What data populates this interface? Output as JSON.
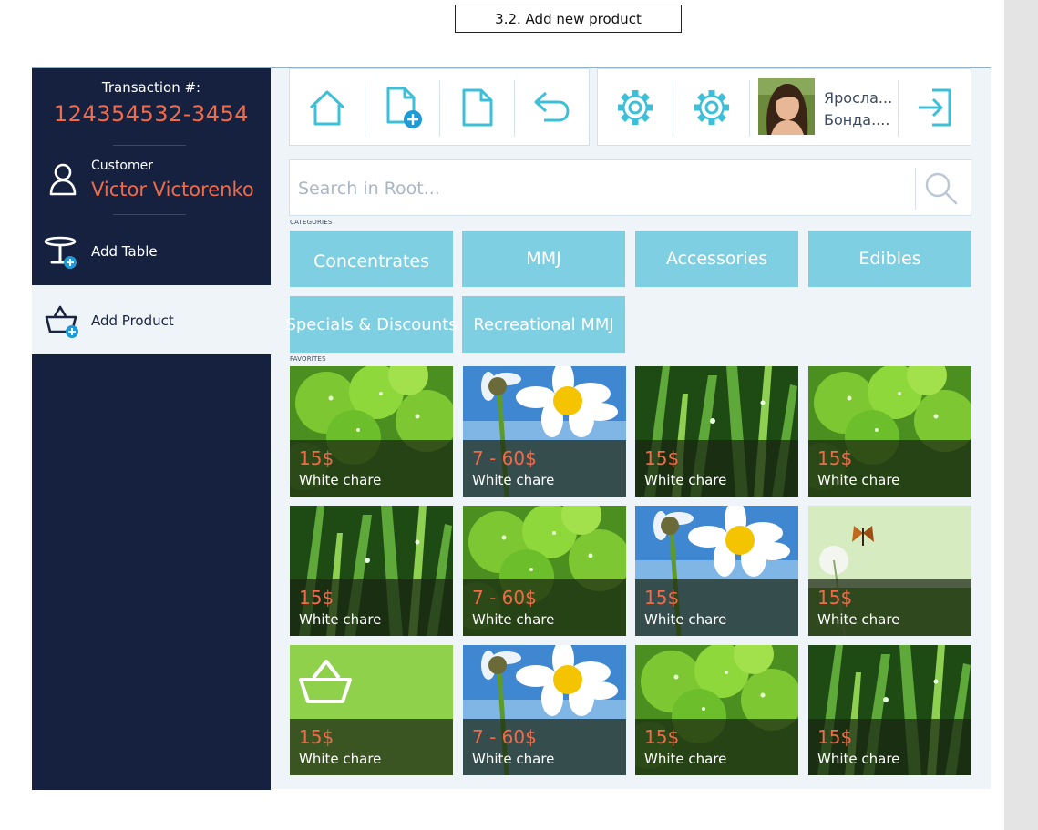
{
  "caption": "3.2. Add new product",
  "colors": {
    "sidebar_bg": "#15213f",
    "accent_orange": "#ef6b4a",
    "category_bg": "#7fcfe2",
    "icon_teal": "#3dbfd8",
    "badge_blue": "#1e9ad6"
  },
  "sidebar": {
    "transaction_label": "Transaction #:",
    "transaction_number": "124354532-3454",
    "customer_label": "Customer",
    "customer_name": "Victor Victorenko",
    "add_table_label": "Add Table",
    "add_product_label": "Add Product"
  },
  "toolbar": {
    "icons": [
      "home-icon",
      "new-document-icon",
      "document-icon",
      "back-arrow-icon",
      "settings-icon",
      "settings-icon",
      "avatar",
      "logout-icon"
    ],
    "user_first": "Яросла...",
    "user_last": "Бонда...."
  },
  "search": {
    "placeholder": "Search in Root..."
  },
  "categories_label": "CATEGORIES",
  "categories": [
    "Concentrates",
    "MMJ",
    "Accessories",
    "Edibles",
    "Specials & Discounts",
    "Recreational MMJ"
  ],
  "favorites_label": "FAVORITES",
  "favorites": [
    {
      "price": "15$",
      "name": "White chare",
      "image": "clover"
    },
    {
      "price": "7 - 60$",
      "name": "White chare",
      "image": "daisy"
    },
    {
      "price": "15$",
      "name": "White chare",
      "image": "grass"
    },
    {
      "price": "15$",
      "name": "White chare",
      "image": "clover"
    },
    {
      "price": "15$",
      "name": "White chare",
      "image": "grass"
    },
    {
      "price": "7 - 60$",
      "name": "White chare",
      "image": "clover"
    },
    {
      "price": "15$",
      "name": "White chare",
      "image": "daisy"
    },
    {
      "price": "15$",
      "name": "White chare",
      "image": "butterfly"
    },
    {
      "price": "15$",
      "name": "White chare",
      "image": "basket"
    },
    {
      "price": "7 - 60$",
      "name": "White chare",
      "image": "daisy"
    },
    {
      "price": "15$",
      "name": "White chare",
      "image": "clover"
    },
    {
      "price": "15$",
      "name": "White chare",
      "image": "grass"
    }
  ]
}
